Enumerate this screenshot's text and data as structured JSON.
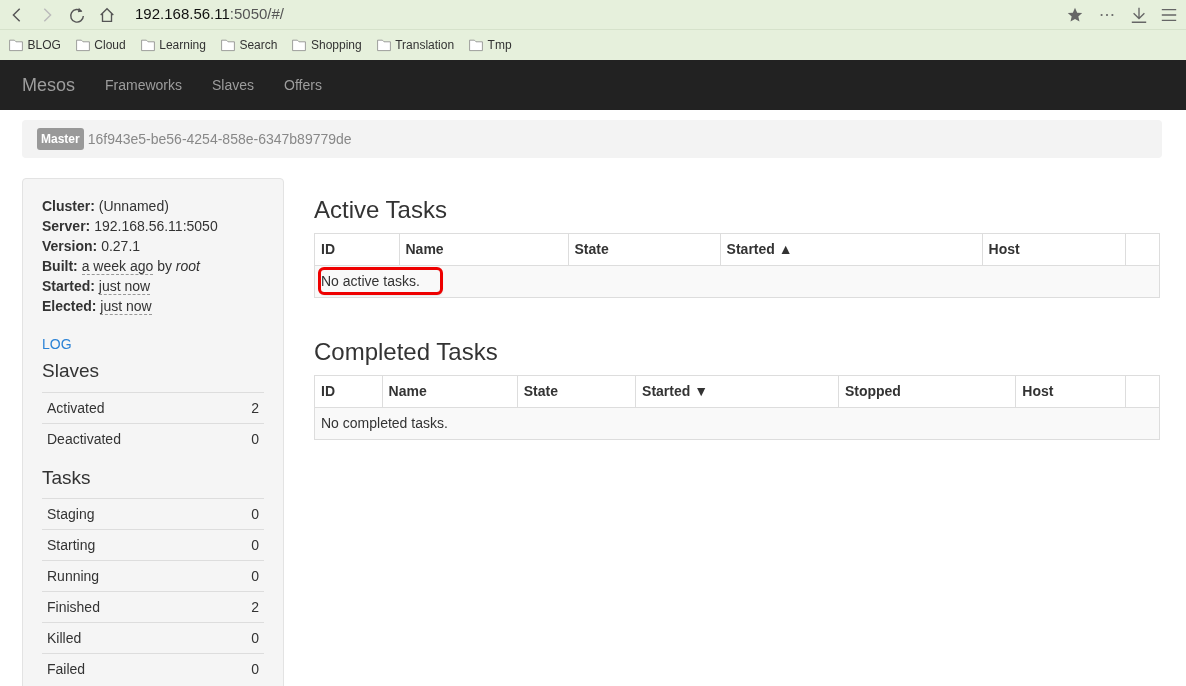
{
  "browser": {
    "url_host": "192.168.56.11",
    "url_rest": ":5050/#/",
    "bookmarks": [
      "BLOG",
      "Cloud",
      "Learning",
      "Search",
      "Shopping",
      "Translation",
      "Tmp"
    ]
  },
  "navbar": {
    "brand": "Mesos",
    "links": [
      "Frameworks",
      "Slaves",
      "Offers"
    ]
  },
  "master": {
    "badge": "Master",
    "id": "16f943e5-be56-4254-858e-6347b89779de"
  },
  "sidebar": {
    "info": [
      {
        "label": "Cluster:",
        "value": "(Unnamed)",
        "dashed": false
      },
      {
        "label": "Server:",
        "value": "192.168.56.11:5050",
        "dashed": false
      },
      {
        "label": "Version:",
        "value": "0.27.1",
        "dashed": false
      },
      {
        "label": "Built:",
        "value": "a week ago",
        "dashed": true,
        "extra": "by *root*"
      },
      {
        "label": "Started:",
        "value": "just now",
        "dashed": true
      },
      {
        "label": "Elected:",
        "value": "just now",
        "dashed": true
      }
    ],
    "log_link": "LOG",
    "sections": [
      {
        "title": "Slaves",
        "rows": [
          {
            "label": "Activated",
            "count": "2"
          },
          {
            "label": "Deactivated",
            "count": "0"
          }
        ]
      },
      {
        "title": "Tasks",
        "rows": [
          {
            "label": "Staging",
            "count": "0"
          },
          {
            "label": "Starting",
            "count": "0"
          },
          {
            "label": "Running",
            "count": "0"
          },
          {
            "label": "Finished",
            "count": "2"
          },
          {
            "label": "Killed",
            "count": "0"
          },
          {
            "label": "Failed",
            "count": "0"
          }
        ]
      }
    ]
  },
  "tables": [
    {
      "title": "Active Tasks",
      "columns": [
        "ID",
        "Name",
        "State",
        "Started ▲",
        "Host"
      ],
      "empty": "No active tasks.",
      "highlighted": true
    },
    {
      "title": "Completed Tasks",
      "columns": [
        "ID",
        "Name",
        "State",
        "Started ▼",
        "Stopped",
        "Host"
      ],
      "empty": "No completed tasks.",
      "highlighted": false
    }
  ]
}
